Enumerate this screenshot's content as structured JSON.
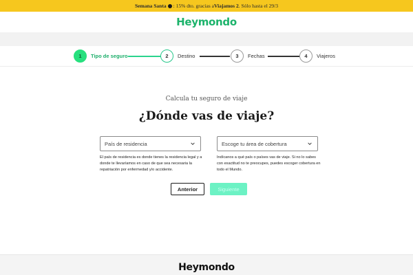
{
  "promo": {
    "bold1": "Semana Santa",
    "text1": ": 15% dto. gracias a ",
    "bold2": "Viajamos 2",
    "text2": ". Sólo hasta el 29/3"
  },
  "header": {
    "logo": "Heymondo"
  },
  "stepper": {
    "steps": [
      {
        "number": "1",
        "label": "Tipo de seguro",
        "state": "active"
      },
      {
        "number": "2",
        "label": "Destino",
        "state": "next"
      },
      {
        "number": "3",
        "label": "Fechas",
        "state": "pending"
      },
      {
        "number": "4",
        "label": "Viajeros",
        "state": "pending"
      }
    ]
  },
  "main": {
    "subtitle": "Calcula tu seguro de viaje",
    "headline": "¿Dónde vas de viaje?",
    "residence": {
      "placeholder": "País de residencia",
      "help": "El país de residencia es donde tienes la residencia legal y a donde te llevaríamos en caso de que sea necesaria la repatriación por enfermedad y/o accidente."
    },
    "coverage": {
      "placeholder": "Escoge tu área de cobertura",
      "help": "Indícanos a qué país o países vas de viaje. Si no lo sabes con exactitud no te preocupes, puedes escoger cobertura en todo el Mundo."
    },
    "back_label": "Anterior",
    "next_label": "Siguiente"
  },
  "footer": {
    "logo": "Heymondo"
  },
  "colors": {
    "brand_green": "#1cb36b",
    "promo_yellow": "#f6c71e",
    "active_step": "#27e07e",
    "next_button": "#6cf2c4"
  }
}
